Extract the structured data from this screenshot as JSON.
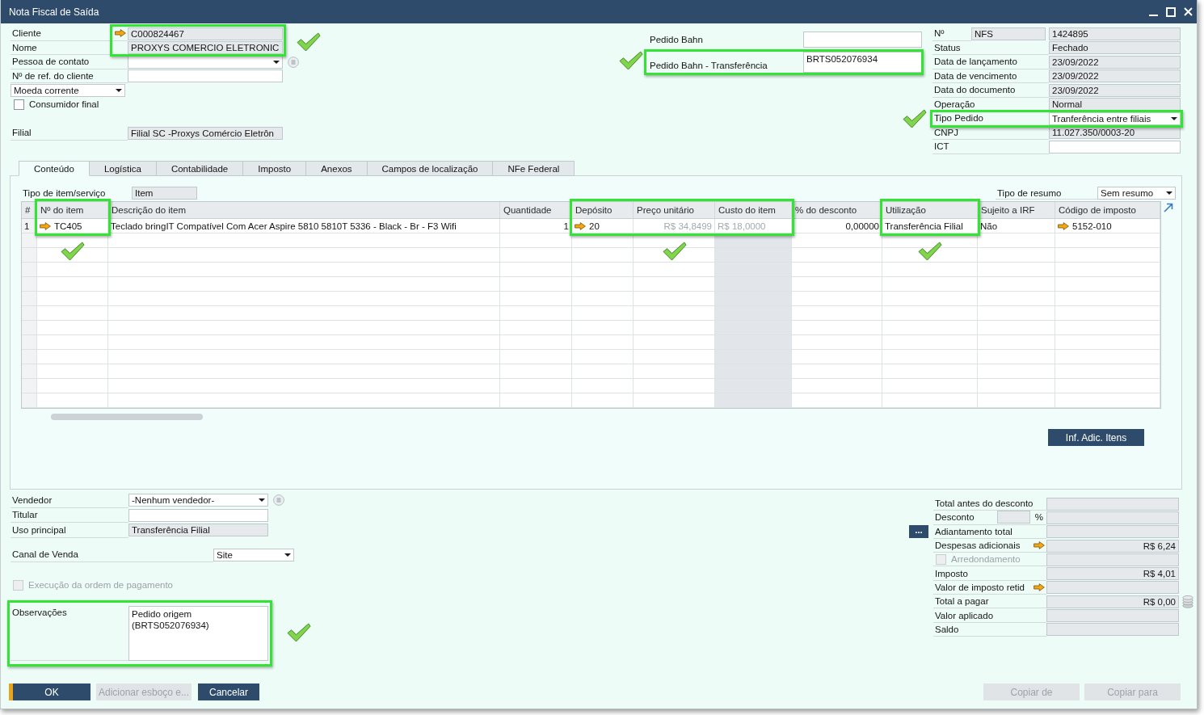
{
  "window": {
    "title": "Nota Fiscal de Saída"
  },
  "header_left": {
    "rows": [
      {
        "kind": "field",
        "label": "Cliente",
        "value": "C000824467",
        "readonly": true,
        "link_arrow": true,
        "info_button": false,
        "highlighted": true,
        "check_mark": true
      },
      {
        "kind": "field",
        "label": "Nome",
        "value": "PROXYS COMERCIO ELETRONIC",
        "readonly": true,
        "link_arrow": false,
        "info_button": false,
        "highlighted": true,
        "check_mark": false
      },
      {
        "kind": "dropdown",
        "label": "Pessoa de contato",
        "info_button": true,
        "highlighted": false,
        "check_mark": false
      },
      {
        "kind": "field",
        "label": "Nº de ref. do cliente",
        "readonly": false,
        "link_arrow": false,
        "info_button": false,
        "highlighted": false,
        "check_mark": false
      },
      {
        "kind": "select",
        "value": "Moeda corrente",
        "highlighted": false,
        "check_mark": false
      },
      {
        "kind": "checkbox",
        "label": "Consumidor final",
        "checked": false,
        "disabled": false,
        "highlighted": false,
        "check_mark": false
      }
    ],
    "branch": {
      "label": "Filial",
      "value": "Filial SC -Proxys Comércio Eletrôn",
      "readonly": true
    }
  },
  "header_middle": {
    "rows": [
      {
        "label": "Pedido Bahn",
        "highlighted": false,
        "check_mark": false
      },
      {
        "label": "Pedido Bahn - Transferência",
        "value": "BRTS052076934",
        "highlighted": true,
        "check_mark": true
      }
    ]
  },
  "header_right": {
    "rows": [
      {
        "kind": "series",
        "label": "Nº",
        "series": "NFS",
        "value": "1424895",
        "readonly": true,
        "highlighted": false,
        "check_mark": false
      },
      {
        "kind": "field",
        "label": "Status",
        "value": "Fechado",
        "readonly": true,
        "highlighted": false,
        "check_mark": false
      },
      {
        "kind": "field",
        "label": "Data de lançamento",
        "value": "23/09/2022",
        "readonly": true,
        "highlighted": false,
        "check_mark": false
      },
      {
        "kind": "field",
        "label": "Data de vencimento",
        "value": "23/09/2022",
        "readonly": true,
        "highlighted": false,
        "check_mark": false
      },
      {
        "kind": "field",
        "label": "Data do documento",
        "value": "23/09/2022",
        "readonly": true,
        "highlighted": false,
        "check_mark": false
      },
      {
        "kind": "field",
        "label": "Operação",
        "value": "Normal",
        "readonly": true,
        "highlighted": false,
        "check_mark": false
      },
      {
        "kind": "dropdown",
        "label": "Tipo Pedido",
        "value": "Tranferência entre filiais",
        "highlighted": true,
        "check_mark": true
      },
      {
        "kind": "field",
        "label": "CNPJ",
        "value": "11.027.350/0003-20",
        "readonly": true,
        "highlighted": false,
        "check_mark": false
      },
      {
        "kind": "field",
        "label": "ICT",
        "readonly": false,
        "highlighted": false,
        "check_mark": false
      }
    ]
  },
  "tabs": [
    {
      "label": "Conteúdo",
      "selected": true
    },
    {
      "label": "Logística",
      "selected": false
    },
    {
      "label": "Contabilidade",
      "selected": false
    },
    {
      "label": "Imposto",
      "selected": false
    },
    {
      "label": "Anexos",
      "selected": false
    },
    {
      "label": "Campos de localização",
      "selected": false
    },
    {
      "label": "NFe Federal",
      "selected": false
    }
  ],
  "items_table": {
    "item_type": {
      "label": "Tipo de item/serviço",
      "value": "Item",
      "readonly": true
    },
    "summary_type": {
      "label": "Tipo de resumo",
      "value": "Sem resumo"
    },
    "columns": [
      {
        "label": "#",
        "kind": "index",
        "link_arrow": false,
        "highlighted": false,
        "check_mark": false,
        "readonly": false,
        "redacted": false
      },
      {
        "label": "Nº do item",
        "kind": "text",
        "link_arrow": true,
        "highlighted": true,
        "check_mark": true,
        "readonly": false,
        "redacted": false
      },
      {
        "label": "Descrição do item",
        "kind": "text",
        "link_arrow": false,
        "highlighted": false,
        "check_mark": false,
        "readonly": false,
        "redacted": false
      },
      {
        "label": "Quantidade",
        "kind": "number",
        "link_arrow": false,
        "highlighted": false,
        "check_mark": false,
        "readonly": false,
        "redacted": false
      },
      {
        "label": "Depósito",
        "kind": "text",
        "link_arrow": true,
        "highlighted": true,
        "check_mark": false,
        "readonly": false,
        "redacted": false
      },
      {
        "label": "Preço unitário",
        "kind": "number",
        "link_arrow": false,
        "highlighted": true,
        "check_mark": true,
        "readonly": false,
        "redacted": true
      },
      {
        "label": "Custo do item",
        "kind": "text",
        "link_arrow": false,
        "highlighted": true,
        "check_mark": false,
        "readonly": true,
        "redacted": true
      },
      {
        "label": "% do desconto",
        "kind": "number",
        "link_arrow": false,
        "highlighted": false,
        "check_mark": false,
        "readonly": false,
        "redacted": false
      },
      {
        "label": "Utilização",
        "kind": "text",
        "link_arrow": false,
        "highlighted": true,
        "check_mark": true,
        "readonly": false,
        "redacted": false
      },
      {
        "label": "Sujeito a IRF",
        "kind": "text",
        "link_arrow": false,
        "highlighted": false,
        "check_mark": false,
        "readonly": false,
        "redacted": false
      },
      {
        "label": "Código de imposto",
        "kind": "text",
        "link_arrow": true,
        "highlighted": false,
        "check_mark": false,
        "readonly": false,
        "redacted": false
      }
    ],
    "rows": [
      {
        "cells": [
          "1",
          "TC405",
          "Teclado bringIT Compatível Com Acer Aspire 5810 5810T 5336 - Black - Br - F3 Wifi",
          "1",
          "20",
          "R$ 34,8499",
          "R$ 18,0000",
          "0,00000",
          "Transferência Filial",
          "Não",
          "5152-010"
        ]
      }
    ]
  },
  "detail_button": {
    "label": "Inf. Adic. Itens"
  },
  "footer_left": {
    "rows": [
      {
        "kind": "dropdown",
        "label": "Vendedor",
        "value": "-Nenhum vendedor-",
        "info_button": true
      },
      {
        "kind": "field",
        "label": "Titular",
        "readonly": false,
        "info_button": false
      },
      {
        "kind": "field",
        "label": "Uso principal",
        "value": "Transferência Filial",
        "readonly": true,
        "info_button": false
      }
    ],
    "sales_channel": {
      "label": "Canal de Venda",
      "value": "Site"
    },
    "payment_order": {
      "label": "Execução da ordem de pagamento",
      "checked": false,
      "disabled": true
    },
    "remarks": {
      "label": "Observações",
      "value": "Pedido origem\n(BRTS052076934)",
      "highlighted": true,
      "check_mark": true
    }
  },
  "totals": {
    "rows": [
      {
        "kind": "field",
        "label": "Total antes do desconto",
        "link_arrow": false
      },
      {
        "kind": "percent",
        "label": "Desconto",
        "unit": "%"
      },
      {
        "kind": "field",
        "label": "Adiantamento total",
        "link_arrow": false,
        "more_button": "..."
      },
      {
        "kind": "field",
        "label": "Despesas adicionais",
        "value": "R$ 6,24",
        "link_arrow": true
      },
      {
        "kind": "checkbox",
        "label": "Arredondamento",
        "checked": false,
        "disabled": true
      },
      {
        "kind": "field",
        "label": "Imposto",
        "value": "R$ 4,01",
        "link_arrow": false
      },
      {
        "kind": "field",
        "label": "Valor de imposto retid",
        "link_arrow": true
      },
      {
        "kind": "field",
        "label": "Total a pagar",
        "value": "R$ 0,00",
        "link_arrow": false,
        "side_icon": true
      },
      {
        "kind": "field",
        "label": "Valor aplicado",
        "link_arrow": false
      },
      {
        "kind": "field",
        "label": "Saldo",
        "link_arrow": false
      }
    ]
  },
  "actions": [
    {
      "label": "OK",
      "default": true,
      "disabled": false
    },
    {
      "label": "Adicionar esboço e...",
      "default": false,
      "disabled": true
    },
    {
      "label": "Cancelar",
      "default": false,
      "disabled": false
    }
  ],
  "copy_actions": [
    {
      "label": "Copiar de",
      "disabled": true
    },
    {
      "label": "Copiar para",
      "disabled": true
    }
  ]
}
